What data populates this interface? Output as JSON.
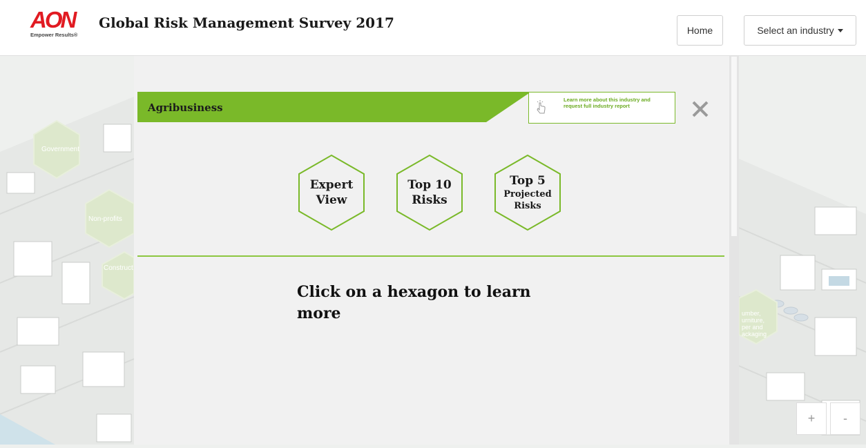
{
  "header": {
    "logo_text": "AON",
    "logo_tagline": "Empower Results®",
    "title": "Global Risk Management Survey 2017",
    "home_label": "Home",
    "industry_select_label": "Select an industry"
  },
  "map": {
    "hex_labels": [
      "Government",
      "Non-profits",
      "Construct",
      "umber,",
      "urniture,",
      "per and",
      "ackaging"
    ]
  },
  "zoom": {
    "in_label": "+",
    "out_label": "-"
  },
  "panel": {
    "industry_name": "Agribusiness",
    "learn_more_text": "Learn more about this industry and request full industry report",
    "close_label": "✕",
    "hexagons": [
      {
        "line1": "Expert",
        "line2": "View",
        "line3": ""
      },
      {
        "line1": "Top 10",
        "line2": "Risks",
        "line3": ""
      },
      {
        "line1": "Top 5",
        "line2": "Projected",
        "line3": "Risks"
      }
    ],
    "instruction": "Click on a hexagon to learn more"
  },
  "colors": {
    "accent_green": "#7ab929",
    "brand_red": "#e11b22",
    "panel_bg": "#f1f1f1"
  }
}
